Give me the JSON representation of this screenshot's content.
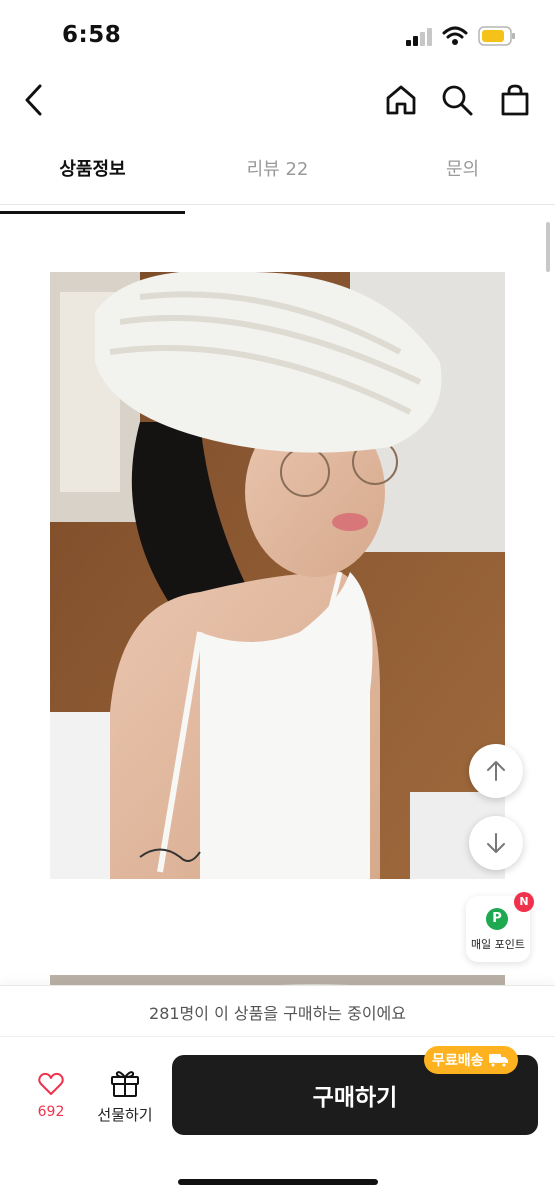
{
  "status_bar": {
    "time": "6:58"
  },
  "icons": {
    "back": "chevron-left-icon",
    "home": "home-icon",
    "search": "search-icon",
    "bag": "shopping-bag-icon",
    "scroll_up": "arrow-up-icon",
    "scroll_down": "arrow-down-icon",
    "heart": "heart-icon",
    "gift": "gift-icon",
    "truck": "truck-icon"
  },
  "tabs": [
    {
      "label": "상품정보",
      "active": true
    },
    {
      "label": "리뷰 22",
      "active": false
    },
    {
      "label": "문의",
      "active": false
    }
  ],
  "points_widget": {
    "p_icon": "P",
    "badge": "N",
    "label": "매일 포인트"
  },
  "purchase_notice": "281명이 이 상품을 구매하는 중이에요",
  "like": {
    "count": "692"
  },
  "gift": {
    "label": "선물하기"
  },
  "buy": {
    "label": "구매하기",
    "badge": "무료배송"
  },
  "colors": {
    "buy_button": "#1c1c1c",
    "badge": "#ffb21f",
    "like": "#f0314b",
    "points": "#1ea84f"
  }
}
